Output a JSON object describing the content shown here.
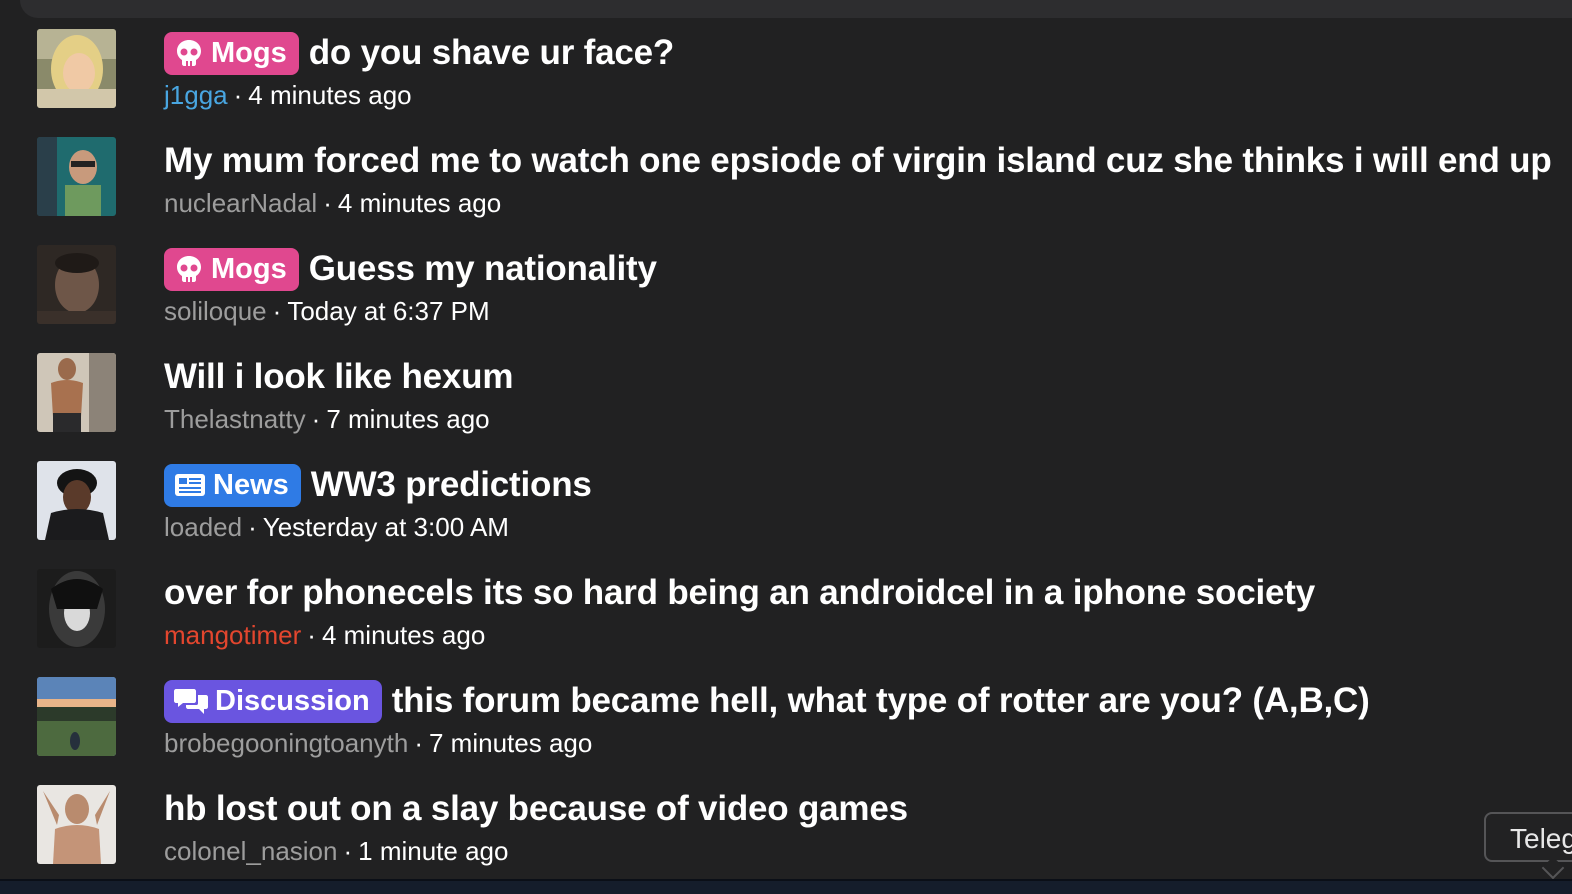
{
  "colors": {
    "background": "#212122",
    "mogs_badge": "#e0488f",
    "news_badge": "#2f7be5",
    "discussion_badge": "#6a55e0",
    "author_default": "#9d9d9d",
    "author_blue": "#49a6e1",
    "author_red": "#e3462e"
  },
  "threads": [
    {
      "badge": {
        "label": "Mogs",
        "icon": "skull-icon"
      },
      "title": "do you shave ur face?",
      "author": "j1gga",
      "author_color": "#49a6e1",
      "time": "4 minutes ago"
    },
    {
      "title": "My mum forced me to watch one epsiode of virgin island cuz she thinks i will end up",
      "author": "nuclearNadal",
      "author_color": "#9d9d9d",
      "time": "4 minutes ago"
    },
    {
      "badge": {
        "label": "Mogs",
        "icon": "skull-icon"
      },
      "title": "Guess my nationality",
      "author": "soliloque",
      "author_color": "#9d9d9d",
      "time": "Today at 6:37 PM"
    },
    {
      "title": "Will i look like hexum",
      "author": "Thelastnatty",
      "author_color": "#9d9d9d",
      "time": "7 minutes ago"
    },
    {
      "badge": {
        "label": "News",
        "icon": "newspaper-icon"
      },
      "title": "WW3 predictions",
      "author": "loaded",
      "author_color": "#9d9d9d",
      "time": "Yesterday at 3:00 AM"
    },
    {
      "title": "over for phonecels its so hard being an androidcel in a iphone society",
      "author": "mangotimer",
      "author_color": "#e3462e",
      "time": "4 minutes ago"
    },
    {
      "badge": {
        "label": "Discussion",
        "icon": "comments-icon"
      },
      "title": "this forum became hell, what type of rotter are you? (A,B,C)",
      "author": "brobegooningtoanyth",
      "author_color": "#9d9d9d",
      "time": "7 minutes ago"
    },
    {
      "title": "hb lost out on a slay because of video games",
      "author": "colonel_nasion",
      "author_color": "#9d9d9d",
      "time": "1 minute ago"
    }
  ],
  "tooltip": {
    "label": "Teleg"
  }
}
